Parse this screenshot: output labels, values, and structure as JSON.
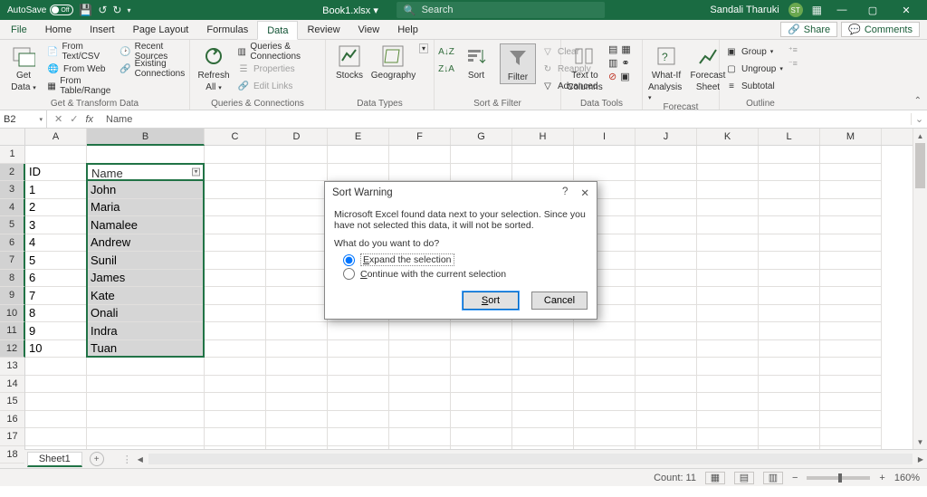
{
  "titlebar": {
    "autosave": "AutoSave",
    "autosave_state": "Off",
    "filename": "Book1.xlsx ▾",
    "search_placeholder": "Search",
    "user_name": "Sandali Tharuki",
    "user_initials": "ST"
  },
  "tabs": {
    "file": "File",
    "items": [
      "Home",
      "Insert",
      "Page Layout",
      "Formulas",
      "Data",
      "Review",
      "View",
      "Help"
    ],
    "active_index": 4,
    "share": "Share",
    "comments": "Comments"
  },
  "ribbon": {
    "groups": {
      "get_transform": {
        "label": "Get & Transform Data",
        "get": "Get",
        "get2": "Data",
        "from_csv": "From Text/CSV",
        "from_web": "From Web",
        "from_table": "From Table/Range",
        "recent": "Recent Sources",
        "existing": "Existing Connections"
      },
      "queries": {
        "label": "Queries & Connections",
        "refresh": "Refresh",
        "refresh2": "All",
        "qc": "Queries & Connections",
        "props": "Properties",
        "links": "Edit Links"
      },
      "datatypes": {
        "label": "Data Types",
        "stocks": "Stocks",
        "geo": "Geography"
      },
      "sortfilter": {
        "label": "Sort & Filter",
        "sort": "Sort",
        "filter": "Filter",
        "clear": "Clear",
        "reapply": "Reapply",
        "advanced": "Advanced"
      },
      "datatools": {
        "label": "Data Tools",
        "ttc": "Text to",
        "ttc2": "Columns"
      },
      "forecast": {
        "label": "Forecast",
        "whatif": "What-If",
        "whatif2": "Analysis",
        "sheet": "Forecast",
        "sheet2": "Sheet"
      },
      "outline": {
        "label": "Outline",
        "group": "Group",
        "ungroup": "Ungroup",
        "subtotal": "Subtotal"
      }
    }
  },
  "formula_bar": {
    "namebox": "B2",
    "value": "Name"
  },
  "grid": {
    "col_widths": {
      "A": 68,
      "B": 130,
      "other": 68
    },
    "columns": [
      "A",
      "B",
      "C",
      "D",
      "E",
      "F",
      "G",
      "H",
      "I",
      "J",
      "K",
      "L",
      "M"
    ],
    "row_count": 18,
    "active_cell": "B2",
    "selection": {
      "col": "B",
      "from_row": 2,
      "to_row": 12
    },
    "data": [
      {
        "A": "ID",
        "B": "Name"
      },
      {
        "A": "1",
        "B": "John"
      },
      {
        "A": "2",
        "B": "Maria"
      },
      {
        "A": "3",
        "B": "Namalee"
      },
      {
        "A": "4",
        "B": "Andrew"
      },
      {
        "A": "5",
        "B": "Sunil"
      },
      {
        "A": "6",
        "B": "James"
      },
      {
        "A": "7",
        "B": "Kate"
      },
      {
        "A": "8",
        "B": "Onali"
      },
      {
        "A": "9",
        "B": "Indra"
      },
      {
        "A": "10",
        "B": "Tuan"
      }
    ]
  },
  "sheets": {
    "active": "Sheet1"
  },
  "status": {
    "count_label": "Count: 11",
    "zoom": "160%"
  },
  "dialog": {
    "title": "Sort Warning",
    "message": "Microsoft Excel found data next to your selection.  Since you have not selected this data, it will not be sorted.",
    "question": "What do you want to do?",
    "opt1": "Expand the selection",
    "opt2": "Continue with the current selection",
    "sort": "Sort",
    "cancel": "Cancel",
    "help": "?",
    "close": "✕"
  }
}
